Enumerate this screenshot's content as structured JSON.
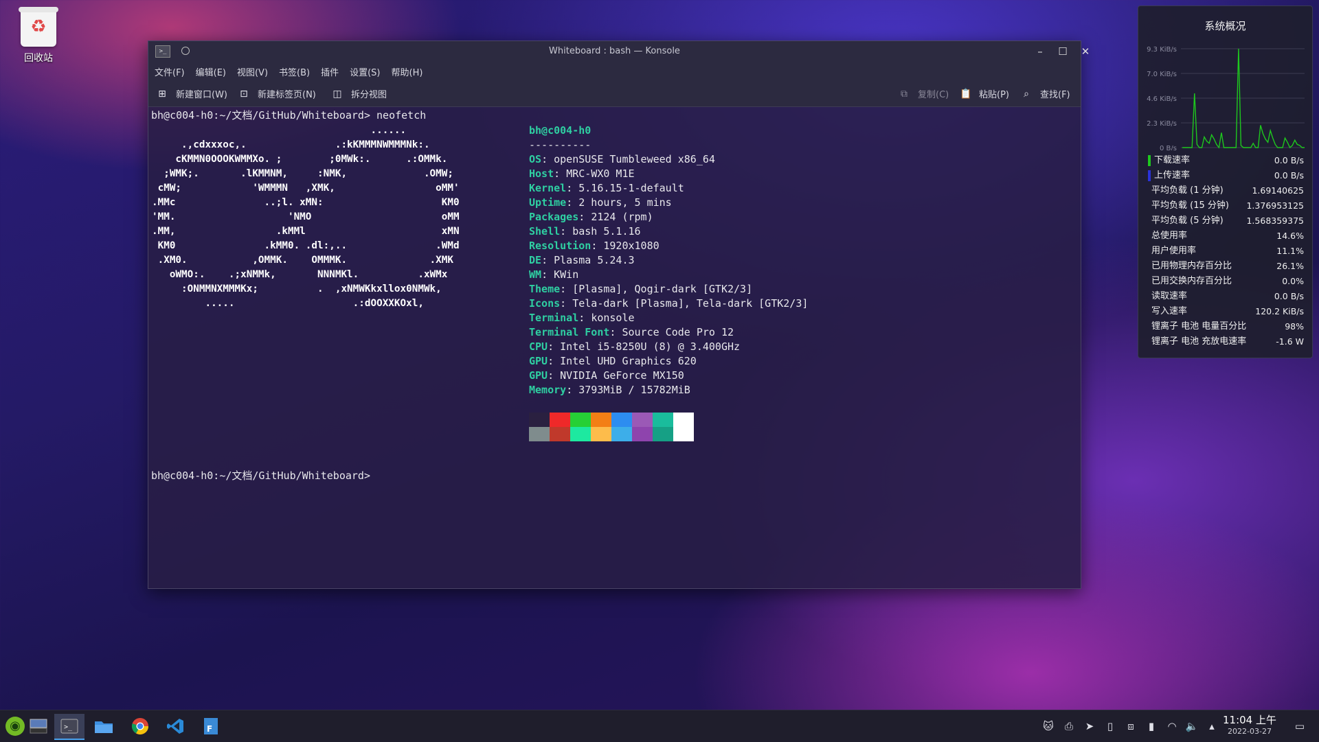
{
  "desktop": {
    "trash_label": "回收站"
  },
  "window": {
    "title": "Whiteboard : bash — Konsole",
    "menu": [
      "文件(F)",
      "编辑(E)",
      "视图(V)",
      "书签(B)",
      "插件",
      "设置(S)",
      "帮助(H)"
    ],
    "toolbar": {
      "new_window": "新建窗口(W)",
      "new_tab": "新建标签页(N)",
      "split_view": "拆分视图",
      "copy": "复制(C)",
      "paste": "粘贴(P)",
      "find": "查找(F)"
    }
  },
  "terminal": {
    "prompt1": "bh@c004-h0:~/文档/GitHub/Whiteboard> neofetch",
    "prompt2": "bh@c004-h0:~/文档/GitHub/Whiteboard> ",
    "ascii_art": "                                     ......\n     .,cdxxxoc,.               .:kKMMMNWMMMNk:.\n    cKMMN0OOOKWMMXo. ;        ;0MWk:.      .:OMMk.\n  ;WMK;.       .lKMMNM,     :NMK,             .OMW;\n cMW;            'WMMMN   ,XMK,                 oMM'\n.MMc               ..;l. xMN:                    KM0\n'MM.                   'NMO                      oMM\n.MM,                 .kMMl                       xMN\n KM0               .kMM0. .dl:,..               .WMd\n .XM0.           ,OMMK.    OMMMK.              .XMK\n   oWMO:.    .;xNMMk,       NNNMKl.          .xWMx\n     :ONMMNXMMMKx;          .  ,xNMWKkxllox0NMWk,\n         .....                    .:dOOXXKOxl,",
    "info_user": "bh@c004-h0",
    "info_sep": "----------",
    "info": [
      {
        "k": "OS",
        "v": "openSUSE Tumbleweed x86_64"
      },
      {
        "k": "Host",
        "v": "MRC-WX0 M1E"
      },
      {
        "k": "Kernel",
        "v": "5.16.15-1-default"
      },
      {
        "k": "Uptime",
        "v": "2 hours, 5 mins"
      },
      {
        "k": "Packages",
        "v": "2124 (rpm)"
      },
      {
        "k": "Shell",
        "v": "bash 5.1.16"
      },
      {
        "k": "Resolution",
        "v": "1920x1080"
      },
      {
        "k": "DE",
        "v": "Plasma 5.24.3"
      },
      {
        "k": "WM",
        "v": "KWin"
      },
      {
        "k": "Theme",
        "v": "[Plasma], Qogir-dark [GTK2/3]"
      },
      {
        "k": "Icons",
        "v": "Tela-dark [Plasma], Tela-dark [GTK2/3]"
      },
      {
        "k": "Terminal",
        "v": "konsole"
      },
      {
        "k": "Terminal Font",
        "v": "Source Code Pro 12"
      },
      {
        "k": "CPU",
        "v": "Intel i5-8250U (8) @ 3.400GHz"
      },
      {
        "k": "GPU",
        "v": "Intel UHD Graphics 620"
      },
      {
        "k": "GPU",
        "v": "NVIDIA GeForce MX150"
      },
      {
        "k": "Memory",
        "v": "3793MiB / 15782MiB"
      }
    ],
    "palette_top": [
      "#2a2040",
      "#ef2929",
      "#26d036",
      "#f37f15",
      "#2d8df0",
      "#9b59b6",
      "#1abc9c",
      "#ffffff"
    ],
    "palette_bottom": [
      "#7f8c8d",
      "#c0392b",
      "#1de9a0",
      "#fdbc4b",
      "#3daee9",
      "#8e44ad",
      "#16a085",
      "#ffffff"
    ]
  },
  "monitor": {
    "title": "系统概况",
    "y_labels": [
      "9.3 KiB/s",
      "7.0 KiB/s",
      "4.6 KiB/s",
      "2.3 KiB/s",
      "0 B/s"
    ],
    "download_color": "#1ec81e",
    "upload_color": "#2a32d8",
    "stats": [
      {
        "label": "下载速率",
        "value": "0.0 B/s"
      },
      {
        "label": "上传速率",
        "value": "0.0 B/s"
      },
      {
        "label": "平均负载 (1 分钟)",
        "value": "1.69140625"
      },
      {
        "label": "平均负载 (15 分钟)",
        "value": "1.376953125"
      },
      {
        "label": "平均负载 (5 分钟)",
        "value": "1.568359375"
      },
      {
        "label": "总使用率",
        "value": "14.6%"
      },
      {
        "label": "用户使用率",
        "value": "11.1%"
      },
      {
        "label": "已用物理内存百分比",
        "value": "26.1%"
      },
      {
        "label": "已用交换内存百分比",
        "value": "0.0%"
      },
      {
        "label": "读取速率",
        "value": "0.0 B/s"
      },
      {
        "label": "写入速率",
        "value": "120.2 KiB/s"
      },
      {
        "label": "锂离子 电池 电量百分比",
        "value": "98%"
      },
      {
        "label": "锂离子 电池 充放电速率",
        "value": "-1.6 W"
      }
    ]
  },
  "taskbar": {
    "time": "11:04 上午",
    "date": "2022-03-27"
  }
}
